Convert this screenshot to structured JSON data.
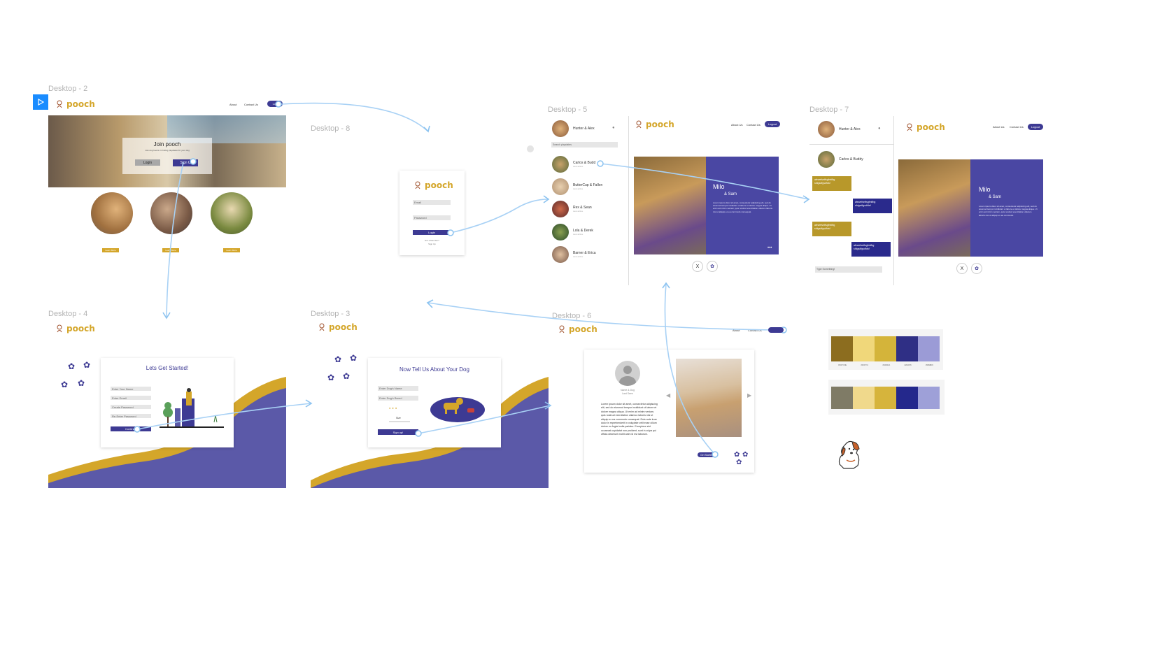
{
  "canvas": {
    "play_icon": "play-icon",
    "frames": {
      "d2": {
        "label": "Desktop - 2",
        "brand": "pooch",
        "nav": [
          "About",
          "Contact Us"
        ],
        "nav_pill": "Log",
        "hero_title": "Join pooch",
        "hero_sub": "Join dog lovers in finding playdates for your dog",
        "login": "Login",
        "signup": "Sign U",
        "learn_more": "Learn More"
      },
      "d8": {
        "label": "Desktop - 8",
        "brand": "pooch",
        "email": "Email",
        "password": "Password",
        "login": "Login",
        "forgot": "Not a Member?",
        "signup": "Sign Up"
      },
      "d5": {
        "label": "Desktop - 5",
        "user": "Hunter & Alex",
        "search_placeholder": "Search playdates",
        "contacts": [
          {
            "name": "Carlos & Budd",
            "sub": "Last active"
          },
          {
            "name": "ButterCup & Fallon",
            "sub": "Last active"
          },
          {
            "name": "Rex & Sean",
            "sub": "Last active"
          },
          {
            "name": "Lola & Derek",
            "sub": "Last active"
          },
          {
            "name": "Barner & Erica",
            "sub": "Last active"
          }
        ],
        "brand": "pooch",
        "nav": [
          "About Us",
          "Contact Us"
        ],
        "logout": "Logout",
        "card_title": "Milo",
        "card_sub": "& Sam",
        "card_text": "Lorem ipsum dolor sit amet, consectetur adipiscing elit, sed do eiusmod tempor incididunt ut labore et dolore magna aliqua. Ut enim ad minim veniam, quis nostrud exercitation ullamco laboris nisi ut aliquip ex ea commodo consequat.",
        "dismiss": "X"
      },
      "d7": {
        "label": "Desktop - 7",
        "user": "Hunter & Alex",
        "contact": "Carlos & Buddy",
        "messages": [
          "afewefsetfsgfmtfbg sfdgsdfgsdfdsf",
          "afewefsetfsgfmtfbg sfdgsdfgsdfdsf",
          "afewefsetfsgfmtfbg sfdgsdfgsdfdsf",
          "afewefsetfsgfmtfbg sfdgsdfgsdfdsf"
        ],
        "input_placeholder": "Type Something!",
        "brand": "pooch",
        "nav": [
          "About Us",
          "Contact Us"
        ],
        "logout": "Logout",
        "card_title": "Milo",
        "card_sub": "& Sam",
        "card_text": "Lorem ipsum dolor sit amet, consectetur adipiscing elit, sed do eiusmod tempor incididunt ut labore et dolore magna aliqua. Ut enim ad minim veniam, quis nostrud exercitation ullamco laboris nisi ut aliquip ex ea commodo.",
        "dismiss": "X"
      },
      "d4": {
        "label": "Desktop - 4",
        "brand": "pooch",
        "title": "Lets Get Started!",
        "fields": [
          "Enter Your Name",
          "Enter Email",
          "Create Password",
          "Re-Enter Password"
        ],
        "continue": "Continue"
      },
      "d3": {
        "label": "Desktop - 3",
        "brand": "pooch",
        "title": "Now Tell Us About Your Dog",
        "fields": [
          "Enter Dog's Name",
          "Enter Dog's Breed"
        ],
        "size_label": "Size",
        "signup": "Sign up!"
      },
      "d6": {
        "label": "Desktop - 6",
        "brand": "pooch",
        "nav": [
          "About",
          "Contact Us"
        ],
        "profile_name": "Name & Dog",
        "profile_sub": "Last Seen",
        "bio": "Lorem ipsum dolor sit amet, consectetur adipiscing elit, sed do eiusmod tempor incididunt ut labore et dolore magna aliqua. Ut enim ad minim veniam, quis nostrud exercitation ullamco laboris nisi ut aliquip ex ea commodo consequat. Duis aute irure dolor in reprehenderit in voluptate velit esse cillum dolore eu fugiat nulla pariatur. Excepteur sint occaecat cupidatat non proident, sunt in culpa qui officia deserunt mollit anim id est laborum.",
        "cta": "Get Started"
      }
    },
    "palettes": [
      {
        "colors": [
          "#8c6d1f",
          "#f0d77a",
          "#d4b43a",
          "#2f2f85",
          "#9b9bd6"
        ],
        "labels": [
          "PANTONE",
          "#F0D77A",
          "#D4B43A",
          "#2F2F85",
          "#9B9BD6"
        ]
      },
      {
        "colors": [
          "#7f7b66",
          "#f0d98c",
          "#d6b43c",
          "#24288c",
          "#9ea0d8"
        ],
        "labels": [
          "",
          "",
          "",
          "",
          ""
        ]
      }
    ],
    "accent": "#3d3a93",
    "gold": "#d4a62a"
  }
}
